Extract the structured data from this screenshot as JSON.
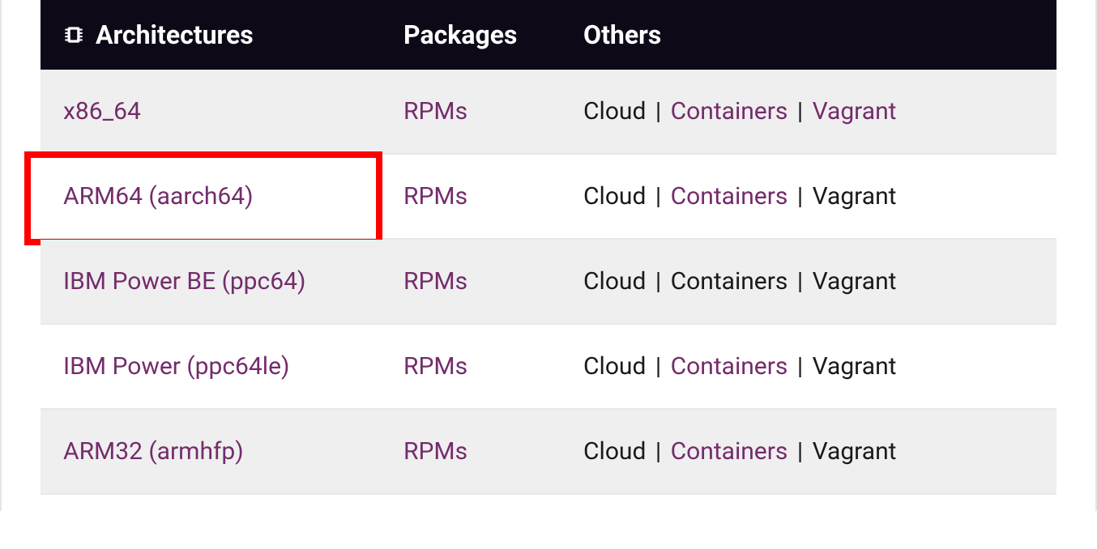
{
  "headers": {
    "architectures": "Architectures",
    "packages": "Packages",
    "others": "Others"
  },
  "rows": [
    {
      "arch": "x86_64",
      "pkg": "RPMs",
      "others": {
        "cloud": "Cloud",
        "cloud_link": false,
        "containers": "Containers",
        "containers_link": true,
        "vagrant": "Vagrant",
        "vagrant_link": true
      },
      "alt": true,
      "highlight": false
    },
    {
      "arch": "ARM64 (aarch64)",
      "pkg": "RPMs",
      "others": {
        "cloud": "Cloud",
        "cloud_link": false,
        "containers": "Containers",
        "containers_link": true,
        "vagrant": "Vagrant",
        "vagrant_link": false
      },
      "alt": false,
      "highlight": true
    },
    {
      "arch": "IBM Power BE (ppc64)",
      "pkg": "RPMs",
      "others": {
        "cloud": "Cloud",
        "cloud_link": false,
        "containers": "Containers",
        "containers_link": false,
        "vagrant": "Vagrant",
        "vagrant_link": false
      },
      "alt": true,
      "highlight": false
    },
    {
      "arch": "IBM Power (ppc64le)",
      "pkg": "RPMs",
      "others": {
        "cloud": "Cloud",
        "cloud_link": false,
        "containers": "Containers",
        "containers_link": true,
        "vagrant": "Vagrant",
        "vagrant_link": false
      },
      "alt": false,
      "highlight": false
    },
    {
      "arch": "ARM32 (armhfp)",
      "pkg": "RPMs",
      "others": {
        "cloud": "Cloud",
        "cloud_link": false,
        "containers": "Containers",
        "containers_link": true,
        "vagrant": "Vagrant",
        "vagrant_link": false
      },
      "alt": true,
      "highlight": false
    }
  ]
}
